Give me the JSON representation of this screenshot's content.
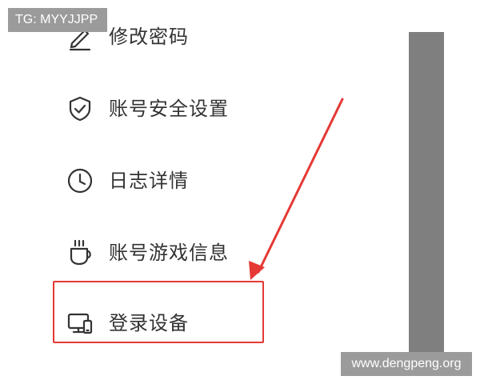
{
  "watermark_tag": "TG: MYYJJPP",
  "watermark_site": "www.dengpeng.org",
  "menu": {
    "items": [
      {
        "label": "修改密码",
        "icon": "pencil-icon"
      },
      {
        "label": "账号安全设置",
        "icon": "shield-check-icon"
      },
      {
        "label": "日志详情",
        "icon": "clock-icon"
      },
      {
        "label": "账号游戏信息",
        "icon": "cup-icon"
      },
      {
        "label": "登录设备",
        "icon": "devices-icon"
      }
    ],
    "highlighted_item": "登录设备"
  },
  "colors": {
    "highlight": "#e53935",
    "text": "#333333",
    "icon": "#333333",
    "scrollbar": "#7f7f7f",
    "watermark_bg": "#9b9b9b"
  }
}
